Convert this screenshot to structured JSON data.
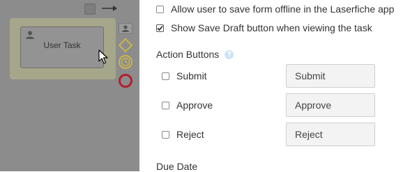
{
  "canvas": {
    "task_label": "User Task"
  },
  "settings": {
    "offline_label": "Allow user to save form offline in the Laserfiche app",
    "offline_checked": false,
    "draft_label": "Show Save Draft button when viewing the task",
    "draft_checked": true
  },
  "action_buttons": {
    "title": "Action Buttons",
    "help_icon": "?",
    "items": [
      {
        "label": "Submit",
        "checked": false,
        "value": "Submit"
      },
      {
        "label": "Approve",
        "checked": false,
        "value": "Approve"
      },
      {
        "label": "Reject",
        "checked": false,
        "value": "Reject"
      }
    ]
  },
  "due_date": {
    "title": "Due Date"
  },
  "colors": {
    "canvas_dim": "#8c8c8c",
    "help_blue": "#cfe3f2",
    "diamond_yellow": "#c9b54a",
    "end_red": "#b0202a"
  }
}
